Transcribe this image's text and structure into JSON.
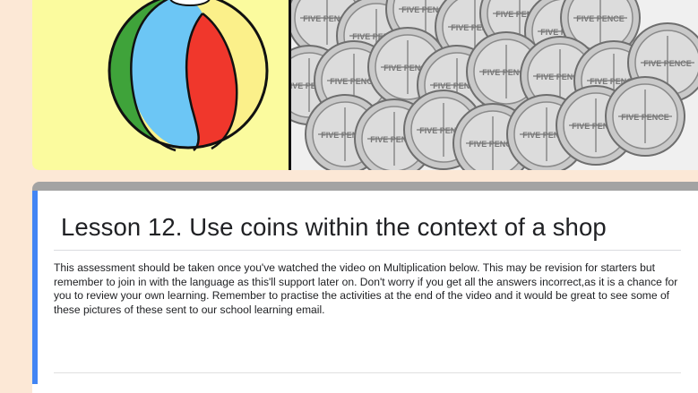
{
  "form": {
    "title": "Lesson 12. Use coins within the context of a shop",
    "description": "This assessment should be taken once you've watched the video on Multiplication below. This may be revision for starters but remember to join in with the language as this'll support later on. Don't worry if you get all the answers incorrect,as it is a chance for you to review your own learning. Remember to practise the activities at the end of the video and it would be great to see some of these pictures of these sent to our school learning email."
  },
  "header_image": {
    "left_picture": "beach-ball",
    "right_picture": "five-pence-coins",
    "coin_text": "FIVE PENCE"
  },
  "colors": {
    "page_background": "#fce8d6",
    "accent": "#4285f4",
    "ball_green": "#3fa33a",
    "ball_blue": "#6cc6f5",
    "ball_red": "#f0372c",
    "ball_yellow": "#fbf08a",
    "panel_yellow": "#fbfb9e"
  }
}
